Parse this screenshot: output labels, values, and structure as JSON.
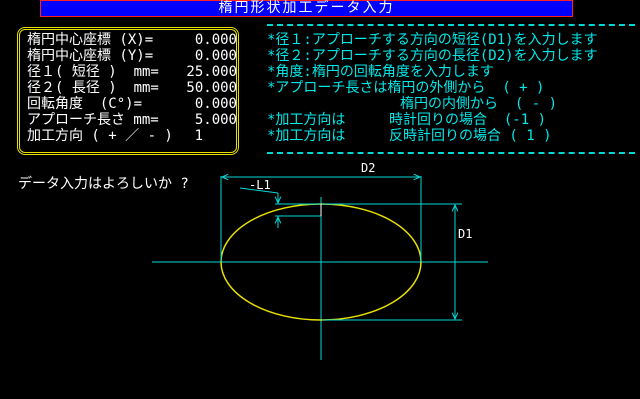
{
  "title": "楕円形状加工データ入力",
  "parameters": [
    {
      "label": "楕円中心座標 (X)=",
      "value": "0.000"
    },
    {
      "label": "楕円中心座標 (Y)=",
      "value": "0.000"
    },
    {
      "label": "径１( 短径 )  mm=",
      "value": "25.000"
    },
    {
      "label": "径２( 長径 )  mm=",
      "value": "50.000"
    },
    {
      "label": "回転角度  (C°)=",
      "value": "0.000"
    },
    {
      "label": "アプローチ長さ mm=",
      "value": "5.000"
    },
    {
      "label": "加工方向 ( + ／ - )",
      "value": "1"
    }
  ],
  "help": {
    "line1": "*径１:アプローチする方向の短径(D1)を入力します",
    "line2": "*径２:アプローチする方向の長径(D2)を入力します",
    "line3": "*角度:楕円の回転角度を入力します",
    "line4": "*アプローチ長さは楕円の外側から  ( + )",
    "line5": "楕円の内側から  ( - )",
    "line6_label": "*加工方向は",
    "line6_text": "時計回りの場合  (-1 )",
    "line7_label": "*加工方向は",
    "line7_text": "反時計回りの場合 ( 1 )"
  },
  "prompt": "データ入力はよろしいか ?",
  "diagram": {
    "label_d2": "D2",
    "label_d1": "D1",
    "label_l1": "-L1",
    "colors": {
      "ellipse": "#e8e000",
      "axis": "#00d8d8",
      "dimension": "#00d8d8"
    }
  }
}
